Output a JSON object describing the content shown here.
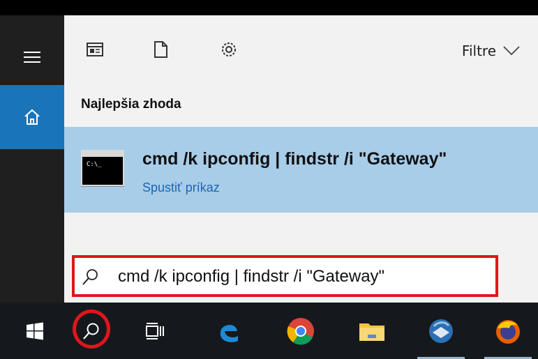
{
  "panel": {
    "filter_label": "Filtre",
    "best_match_heading": "Najlepšia zhoda"
  },
  "result": {
    "title": "cmd /k ipconfig | findstr /i \"Gateway\"",
    "subtitle": "Spustiť príkaz",
    "icon_text": "C:\\_"
  },
  "search": {
    "value": "cmd /k ipconfig | findstr /i \"Gateway\""
  },
  "taskbar": {
    "items": [
      "windows-start",
      "search",
      "task-view",
      "edge",
      "chrome",
      "file-explorer",
      "thunderbird",
      "firefox"
    ]
  },
  "colors": {
    "accent": "#1a74b8",
    "result_highlight": "#a8cde9",
    "annotation_red": "#e0161c",
    "taskbar": "#15191d"
  }
}
